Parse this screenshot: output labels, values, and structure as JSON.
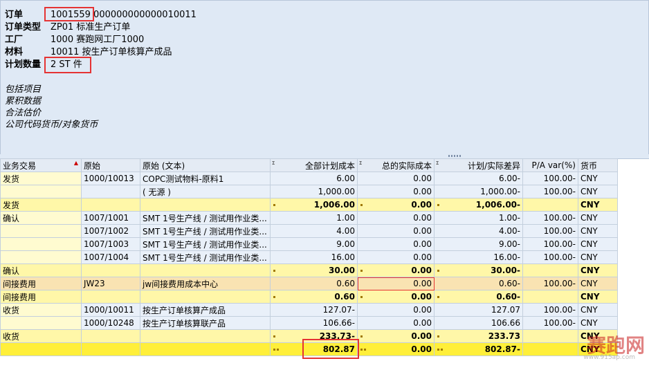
{
  "header": {
    "order_label": "订单",
    "order_value": "1001559",
    "order_extra": "000000000000010011",
    "order_type_label": "订单类型",
    "order_type_value": "ZP01 标准生产订单",
    "plant_label": "工厂",
    "plant_value": "1000 赛跑网工厂1000",
    "material_label": "材料",
    "material_value": "10011 按生产订单核算产成品",
    "qty_label": "计划数量",
    "qty_value": "2 ST 件",
    "options": [
      "包括项目",
      "累积数据",
      "合法估价",
      "公司代码货币/对象货币"
    ]
  },
  "columns": [
    "业务交易",
    "原始",
    "原始 (文本)",
    "全部计划成本",
    "总的实际成本",
    "计划/实际差异",
    "P/A var(%)",
    "货币"
  ],
  "rows": [
    {
      "kind": "row",
      "cat": "发货",
      "orig": "1000/10013",
      "text": "COPC测试物料-原料1",
      "plan": "6.00",
      "actual": "0.00",
      "diff": "6.00-",
      "pct": "100.00-",
      "cur": "CNY"
    },
    {
      "kind": "row",
      "cat": "",
      "orig": "",
      "text": "( 无源 )",
      "plan": "1,000.00",
      "actual": "0.00",
      "diff": "1,000.00-",
      "pct": "100.00-",
      "cur": "CNY"
    },
    {
      "kind": "sum",
      "cat": "发货",
      "orig": "",
      "text": "",
      "plan": "1,006.00",
      "actual": "0.00",
      "diff": "1,006.00-",
      "pct": "",
      "cur": "CNY"
    },
    {
      "kind": "row",
      "cat": "确认",
      "orig": "1007/1001",
      "text": "SMT 1号生产线 / 测试用作业类...",
      "plan": "1.00",
      "actual": "0.00",
      "diff": "1.00-",
      "pct": "100.00-",
      "cur": "CNY"
    },
    {
      "kind": "row",
      "cat": "",
      "orig": "1007/1002",
      "text": "SMT 1号生产线 / 测试用作业类...",
      "plan": "4.00",
      "actual": "0.00",
      "diff": "4.00-",
      "pct": "100.00-",
      "cur": "CNY"
    },
    {
      "kind": "row",
      "cat": "",
      "orig": "1007/1003",
      "text": "SMT 1号生产线 / 测试用作业类...",
      "plan": "9.00",
      "actual": "0.00",
      "diff": "9.00-",
      "pct": "100.00-",
      "cur": "CNY"
    },
    {
      "kind": "row",
      "cat": "",
      "orig": "1007/1004",
      "text": "SMT 1号生产线 / 测试用作业类...",
      "plan": "16.00",
      "actual": "0.00",
      "diff": "16.00-",
      "pct": "100.00-",
      "cur": "CNY"
    },
    {
      "kind": "sum",
      "cat": "确认",
      "orig": "",
      "text": "",
      "plan": "30.00",
      "actual": "0.00",
      "diff": "30.00-",
      "pct": "",
      "cur": "CNY"
    },
    {
      "kind": "sel",
      "cat": "间接费用",
      "orig": "JW23",
      "text": "jw间接费用成本中心",
      "plan": "0.60",
      "actual": "0.00",
      "diff": "0.60-",
      "pct": "100.00-",
      "cur": "CNY"
    },
    {
      "kind": "sum",
      "cat": "间接费用",
      "orig": "",
      "text": "",
      "plan": "0.60",
      "actual": "0.00",
      "diff": "0.60-",
      "pct": "",
      "cur": "CNY"
    },
    {
      "kind": "row",
      "cat": "收货",
      "orig": "1000/10011",
      "text": "按生产订单核算产成品",
      "plan": "127.07-",
      "actual": "0.00",
      "diff": "127.07",
      "pct": "100.00-",
      "cur": "CNY"
    },
    {
      "kind": "row",
      "cat": "",
      "orig": "1000/10248",
      "text": "按生产订单核算联产品",
      "plan": "106.66-",
      "actual": "0.00",
      "diff": "106.66",
      "pct": "100.00-",
      "cur": "CNY"
    },
    {
      "kind": "sum",
      "cat": "收货",
      "orig": "",
      "text": "",
      "plan": "233.73-",
      "actual": "0.00",
      "diff": "233.73",
      "pct": "",
      "cur": "CNY"
    },
    {
      "kind": "tot",
      "cat": "",
      "orig": "",
      "text": "",
      "plan": "802.87",
      "actual": "0.00",
      "diff": "802.87-",
      "pct": "",
      "cur": "CNY"
    }
  ],
  "watermark": {
    "main": "赛跑网",
    "sub": "www.915ap.com"
  }
}
